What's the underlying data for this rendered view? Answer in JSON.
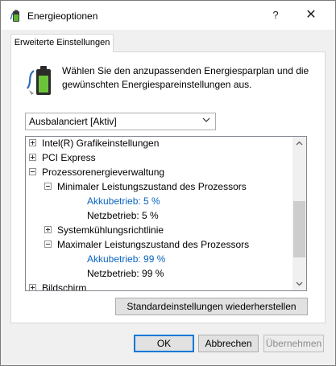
{
  "window": {
    "title": "Energieoptionen",
    "help_label": "?",
    "close_label": "✕",
    "icon": "battery-power-icon"
  },
  "tab": {
    "label": "Erweiterte Einstellungen"
  },
  "description": "Wählen Sie den anzupassenden Energiesparplan und die gewünschten Energiespareinstellungen aus.",
  "plan_select": {
    "value": "Ausbalanciert [Aktiv]"
  },
  "tree": {
    "items": [
      {
        "label": "Intel(R) Grafikeinstellungen",
        "state": "collapsed"
      },
      {
        "label": "PCI Express",
        "state": "collapsed"
      },
      {
        "label": "Prozessorenergieverwaltung",
        "state": "expanded"
      },
      {
        "label": "Minimaler Leistungszustand des Prozessors",
        "state": "expanded"
      },
      {
        "label": "Akkubetrieb: 5 %",
        "state": "value",
        "highlight": true
      },
      {
        "label": "Netzbetrieb: 5 %",
        "state": "value"
      },
      {
        "label": "Systemkühlungsrichtlinie",
        "state": "collapsed"
      },
      {
        "label": "Maximaler Leistungszustand des Prozessors",
        "state": "expanded"
      },
      {
        "label": "Akkubetrieb: 99 %",
        "state": "value",
        "highlight": true
      },
      {
        "label": "Netzbetrieb: 99 %",
        "state": "value"
      },
      {
        "label": "Bildschirm",
        "state": "collapsed"
      }
    ]
  },
  "buttons": {
    "restore": "Standardeinstellungen wiederherstellen",
    "ok": "OK",
    "cancel": "Abbrechen",
    "apply": "Übernehmen"
  },
  "colors": {
    "accent": "#0078d7",
    "value_text": "#0a64c0"
  }
}
